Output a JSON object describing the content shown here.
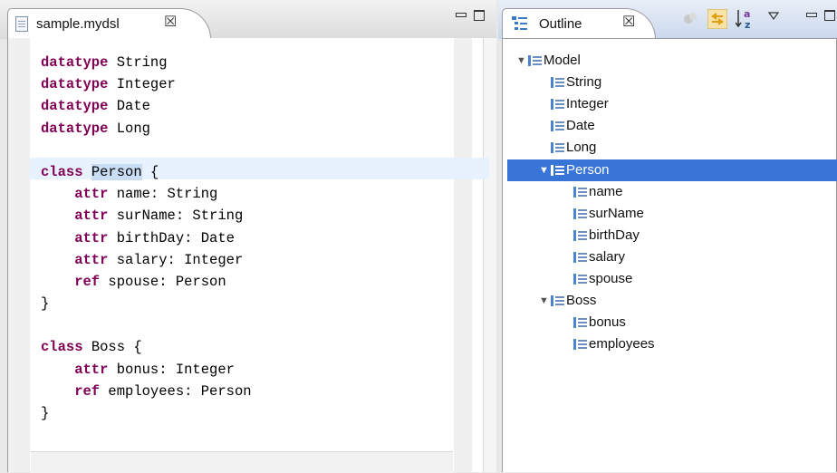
{
  "editor": {
    "tab_title": "sample.mydsl",
    "close_glyph": "☒",
    "lines": [
      {
        "kw": "datatype",
        "rest": " String"
      },
      {
        "kw": "datatype",
        "rest": " Integer"
      },
      {
        "kw": "datatype",
        "rest": " Date"
      },
      {
        "kw": "datatype",
        "rest": " Long"
      },
      {
        "kw": "",
        "rest": ""
      },
      {
        "kw": "class",
        "rest": " ",
        "sel": "Person",
        "after": " {"
      },
      {
        "kw": "    attr",
        "rest": " name: String"
      },
      {
        "kw": "    attr",
        "rest": " surName: String"
      },
      {
        "kw": "    attr",
        "rest": " birthDay: Date"
      },
      {
        "kw": "    attr",
        "rest": " salary: Integer"
      },
      {
        "kw": "    ref",
        "rest": " spouse: Person"
      },
      {
        "kw": "",
        "rest": "}"
      },
      {
        "kw": "",
        "rest": ""
      },
      {
        "kw": "class",
        "rest": " Boss {"
      },
      {
        "kw": "    attr",
        "rest": " bonus: Integer"
      },
      {
        "kw": "    ref",
        "rest": " employees: Person"
      },
      {
        "kw": "",
        "rest": "}"
      }
    ]
  },
  "outline": {
    "tab_title": "Outline",
    "close_glyph": "☒",
    "toolbar": {
      "filter_icon": "filter-icon",
      "link_icon": "link-with-editor-icon",
      "sort_icon": "sort-alphabetically-icon",
      "menu_icon": "view-menu-icon"
    },
    "tree": [
      {
        "label": "Model",
        "depth": 0,
        "expanded": true
      },
      {
        "label": "String",
        "depth": 1
      },
      {
        "label": "Integer",
        "depth": 1
      },
      {
        "label": "Date",
        "depth": 1
      },
      {
        "label": "Long",
        "depth": 1
      },
      {
        "label": "Person",
        "depth": 1,
        "expanded": true,
        "selected": true
      },
      {
        "label": "name",
        "depth": 2
      },
      {
        "label": "surName",
        "depth": 2
      },
      {
        "label": "birthDay",
        "depth": 2
      },
      {
        "label": "salary",
        "depth": 2
      },
      {
        "label": "spouse",
        "depth": 2
      },
      {
        "label": "Boss",
        "depth": 1,
        "expanded": true
      },
      {
        "label": "bonus",
        "depth": 2
      },
      {
        "label": "employees",
        "depth": 2
      }
    ]
  },
  "colors": {
    "keyword": "#7f0055",
    "selection": "#3875d7",
    "current_line": "#e8f2fe"
  }
}
